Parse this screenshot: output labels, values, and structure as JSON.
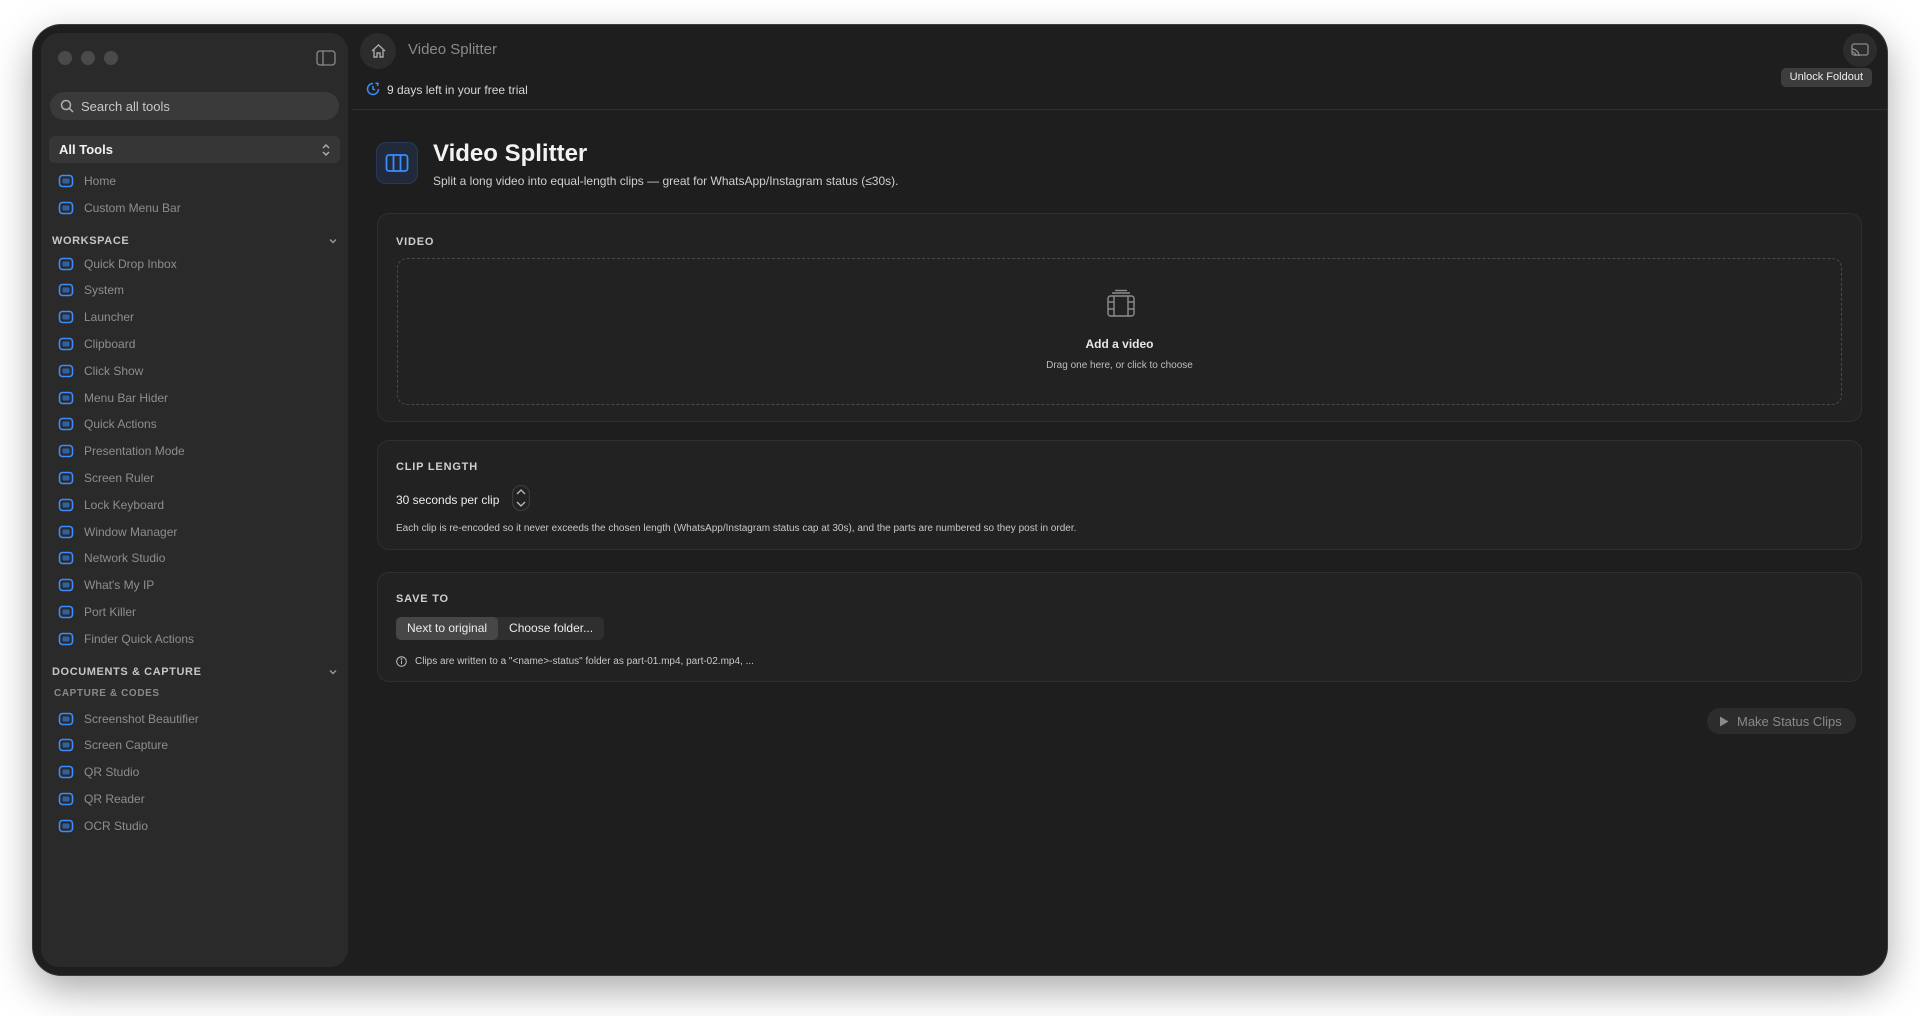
{
  "window": {
    "title": "Video Splitter"
  },
  "sidebar": {
    "search_placeholder": "Search all tools",
    "filter": "All Tools",
    "top_items": [
      {
        "label": "Home",
        "icon": "house-icon"
      },
      {
        "label": "Custom Menu Bar",
        "icon": "menubar-icon"
      }
    ],
    "sections": [
      {
        "title": "WORKSPACE",
        "items": [
          {
            "label": "Quick Drop Inbox",
            "icon": "inbox-icon"
          },
          {
            "label": "System",
            "icon": "system-icon"
          },
          {
            "label": "Launcher",
            "icon": "command-icon"
          },
          {
            "label": "Clipboard",
            "icon": "clipboard-icon"
          },
          {
            "label": "Click Show",
            "icon": "click-icon"
          },
          {
            "label": "Menu Bar Hider",
            "icon": "menubar-hider-icon"
          },
          {
            "label": "Quick Actions",
            "icon": "quick-actions-icon"
          },
          {
            "label": "Presentation Mode",
            "icon": "presentation-icon"
          },
          {
            "label": "Screen Ruler",
            "icon": "ruler-icon"
          },
          {
            "label": "Lock Keyboard",
            "icon": "lock-icon"
          },
          {
            "label": "Window Manager",
            "icon": "window-icon"
          },
          {
            "label": "Network Studio",
            "icon": "network-icon"
          },
          {
            "label": "What's My IP",
            "icon": "globe-icon"
          },
          {
            "label": "Port Killer",
            "icon": "port-icon"
          },
          {
            "label": "Finder Quick Actions",
            "icon": "sparkle-icon"
          }
        ]
      },
      {
        "title": "DOCUMENTS & CAPTURE",
        "subtitle": "CAPTURE & CODES",
        "items": [
          {
            "label": "Screenshot Beautifier",
            "icon": "image-icon"
          },
          {
            "label": "Screen Capture",
            "icon": "capture-icon"
          },
          {
            "label": "QR Studio",
            "icon": "qr-icon"
          },
          {
            "label": "QR Reader",
            "icon": "qr-scan-icon"
          },
          {
            "label": "OCR Studio",
            "icon": "ocr-icon"
          }
        ]
      }
    ]
  },
  "trial": {
    "text": "9 days left in your free trial",
    "button": "Unlock Foldout"
  },
  "page": {
    "title": "Video Splitter",
    "subtitle": "Split a long video into equal-length clips — great for WhatsApp/Instagram status (≤30s)."
  },
  "video_card": {
    "label": "VIDEO",
    "drop_title": "Add a video",
    "drop_hint": "Drag one here, or click to choose"
  },
  "clip_card": {
    "label": "CLIP LENGTH",
    "value": "30 seconds per clip",
    "hint": "Each clip is re-encoded so it never exceeds the chosen length (WhatsApp/Instagram status cap at 30s), and the parts are numbered so they post in order."
  },
  "save_card": {
    "label": "SAVE TO",
    "options": [
      "Next to original",
      "Choose folder..."
    ],
    "selected": "Next to original",
    "info": "Clips are written to a \"<name>-status\" folder as part-01.mp4, part-02.mp4, ..."
  },
  "action": {
    "label": "Make Status Clips"
  },
  "colors": {
    "accent": "#3a8cff",
    "background": "#1e1e1e",
    "sidebar": "#2a2a2a"
  }
}
